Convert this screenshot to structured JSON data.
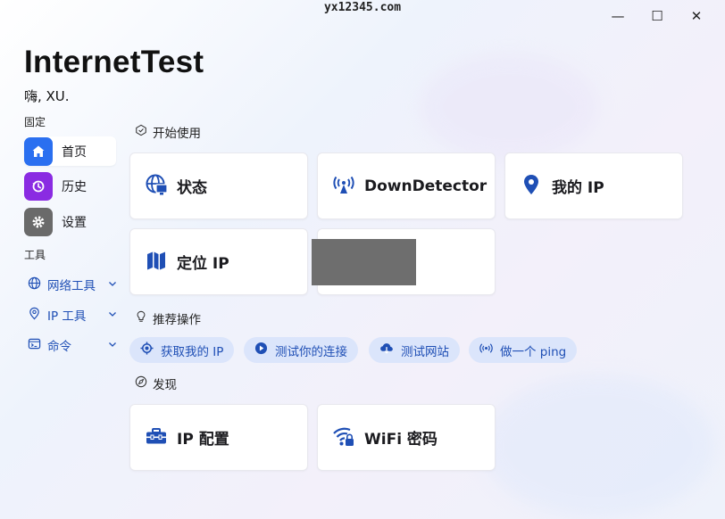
{
  "watermark": "yx12345.com",
  "window": {
    "minimize": "—",
    "maximize": "☐",
    "close": "✕"
  },
  "app": {
    "title": "InternetTest",
    "greeting": "嗨, XU."
  },
  "sidebar": {
    "pinned_label": "固定",
    "pinned": [
      {
        "label": "首页",
        "icon": "home-icon",
        "color": "#2a6ff0"
      },
      {
        "label": "历史",
        "icon": "history-icon",
        "color": "#8a2be2"
      },
      {
        "label": "设置",
        "icon": "gear-icon",
        "color": "#6a6a6a"
      }
    ],
    "tools_label": "工具",
    "tools": [
      {
        "label": "网络工具",
        "icon": "globe-icon"
      },
      {
        "label": "IP 工具",
        "icon": "location-pin-icon"
      },
      {
        "label": "命令",
        "icon": "terminal-icon"
      }
    ]
  },
  "main": {
    "start": {
      "title": "开始使用",
      "cards": [
        {
          "label": "状态",
          "icon": "globe-status-icon"
        },
        {
          "label": "DownDetector",
          "icon": "antenna-icon"
        },
        {
          "label": "我的 IP",
          "icon": "location-pin-icon"
        },
        {
          "label": "定位 IP",
          "icon": "map-icon"
        }
      ]
    },
    "recommended": {
      "title": "推荐操作",
      "chips": [
        {
          "label": "获取我的 IP",
          "icon": "target-icon"
        },
        {
          "label": "测试你的连接",
          "icon": "play-icon"
        },
        {
          "label": "测试网站",
          "icon": "cloud-icon"
        },
        {
          "label": "做一个 ping",
          "icon": "broadcast-icon"
        }
      ]
    },
    "discover": {
      "title": "发现",
      "cards": [
        {
          "label": "IP 配置",
          "icon": "toolbox-icon"
        },
        {
          "label": "WiFi 密码",
          "icon": "wifi-lock-icon"
        }
      ]
    }
  },
  "colors": {
    "accent": "#2a6ff0",
    "accent_text": "#1f4fb5",
    "chip_bg": "#dbe5fb"
  }
}
